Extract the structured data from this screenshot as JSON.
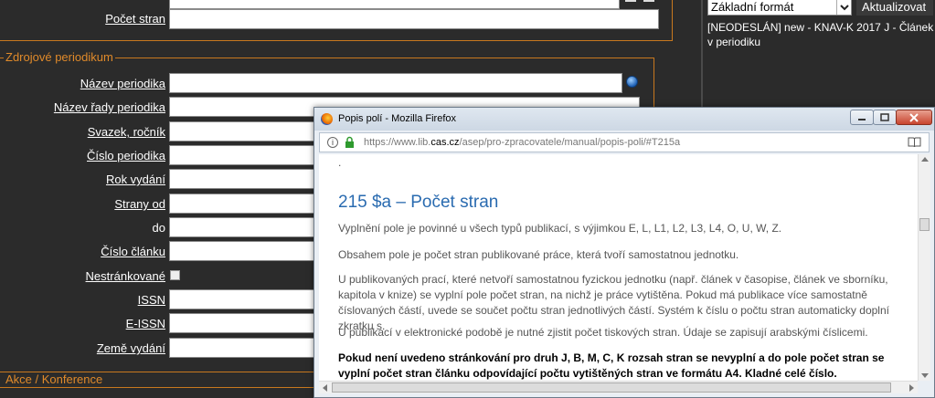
{
  "form": {
    "pages_label": "Počet stran",
    "section_source_periodical": "Zdrojové periodikum",
    "fields": [
      {
        "label": "Název periodika",
        "underline": true
      },
      {
        "label": "Název řady periodika",
        "underline": true
      },
      {
        "label": "Svazek, ročník",
        "underline": true
      },
      {
        "label": "Číslo periodika",
        "underline": true
      },
      {
        "label": "Rok vydání",
        "underline": true
      },
      {
        "label": "Strany od",
        "underline": true
      },
      {
        "label": "do",
        "underline": false
      },
      {
        "label": "Číslo článku",
        "underline": true
      }
    ],
    "unpaged_label": "Nestránkované",
    "issn_label": "ISSN",
    "eissn_label": "E-ISSN",
    "country_label": "Země vydání",
    "section_event": "Akce / Konference"
  },
  "right_panel": {
    "format_select": "Základní formát",
    "update_button": "Aktualizovat",
    "record_text": "[NEODESLÁN] new - KNAV-K 2017 J - Článek v periodiku"
  },
  "popup": {
    "window_title": "Popis polí - Mozilla Firefox",
    "url_prefix": "https://www.lib.",
    "url_domain": "cas.cz",
    "url_suffix": "/asep/pro-zpracovatele/manual/popis-poli/#T215a",
    "dot": ".",
    "heading": "215 $a – Počet stran",
    "paragraphs": [
      "Vyplnění pole je povinné u všech typů publikací, s výjimkou E, L, L1, L2, L3, L4, O, U, W, Z.",
      "Obsahem pole je počet stran publikované práce, která tvoří samostatnou jednotku.",
      "U publikovaných prací, které netvoří samostatnou fyzickou jednotku (např. článek v časopise, článek ve sborníku, kapitola v knize) se vyplní pole počet stran, na nichž je práce vytištěna. Pokud má publikace více samostatně číslovaných částí, uvede se součet počtu stran jednotlivých částí. Systém k číslu o počtu stran automaticky doplní zkratku s.",
      "U publikací v elektronické podobě je nutné zjistit počet tiskových stran. Údaje se zapisují arabskými číslicemi."
    ],
    "bold_paragraph": "Pokud není uvedeno stránkování pro druh J, B, M, C, K rozsah stran se nevyplní a do pole počet stran se vyplní počet stran článku odpovídající počtu vytištěných stran ve formátu A4. Kladné celé číslo."
  },
  "colors": {
    "accent": "#c8781e",
    "heading": "#2a6bb0",
    "background": "#2b2b2b"
  }
}
